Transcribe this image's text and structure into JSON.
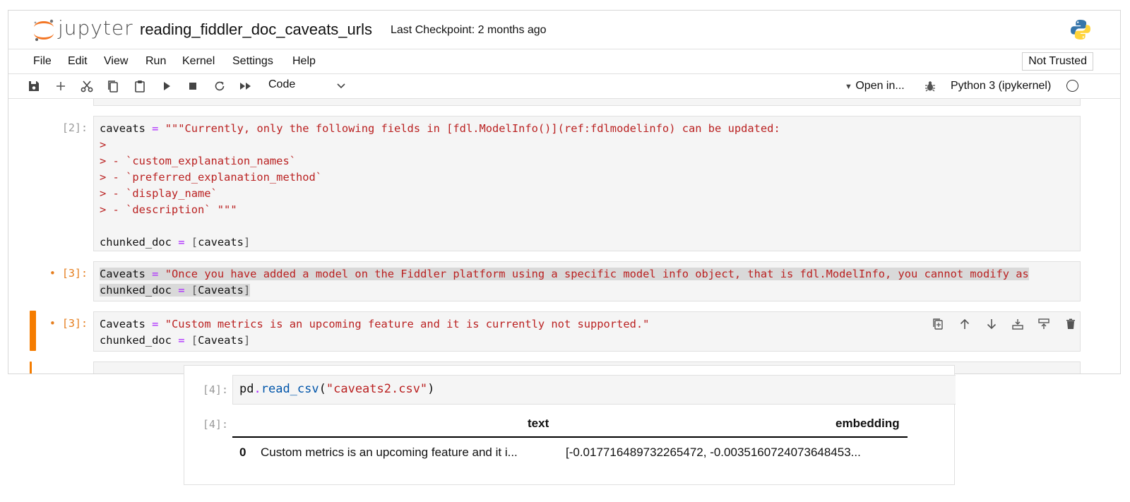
{
  "header": {
    "logo_text": "jupyter",
    "notebook_title": "reading_fiddler_doc_caveats_urls",
    "checkpoint": "Last Checkpoint: 2 months ago"
  },
  "menu": {
    "items": [
      "File",
      "Edit",
      "View",
      "Run",
      "Kernel",
      "Settings",
      "Help"
    ],
    "trust_badge": "Not Trusted"
  },
  "toolbar": {
    "icons": [
      "save-icon",
      "add-icon",
      "cut-icon",
      "copy-icon",
      "paste-icon",
      "run-icon",
      "stop-icon",
      "restart-icon",
      "fast-forward-icon"
    ],
    "cell_type": "Code",
    "open_in": "Open in...",
    "kernel": "Python 3 (ipykernel)"
  },
  "cells": {
    "c2": {
      "prompt": "[2]:",
      "l1a": "caveats",
      "l1op": "=",
      "l1s": "\"\"\"Currently, only the following fields in [fdl.ModelInfo()](ref:fdlmodelinfo) can be updated:",
      "l2": ">",
      "l3": "> - `custom_explanation_names`",
      "l4": "> - `preferred_explanation_method`",
      "l5": "> - `display_name`",
      "l6": "> - `description` \"\"\"",
      "l8a": "chunked_doc",
      "l8op": "=",
      "l8b": "[",
      "l8c": "caveats",
      "l8d": "]"
    },
    "c3a": {
      "prompt": "• [3]:",
      "l1a": "Caveats",
      "l1op": "=",
      "l1s": "\"Once you have added a model on the Fiddler platform using a specific model info object, that is fdl.ModelInfo, you cannot modify as",
      "l2a": "chunked_doc",
      "l2op": "=",
      "l2b": "[",
      "l2c": "Caveats",
      "l2d": "]"
    },
    "c3b": {
      "prompt": "• [3]:",
      "l1a": "Caveats",
      "l1op": "=",
      "l1s": "\"Custom metrics is an upcoming feature and it is currently not supported.\"",
      "l2a": "chunked_doc",
      "l2op": "=",
      "l2b": "[",
      "l2c": "Caveats",
      "l2d": "]",
      "actions": [
        "duplicate-icon",
        "move-up-icon",
        "move-down-icon",
        "insert-above-icon",
        "insert-below-icon",
        "delete-icon"
      ]
    },
    "c4": {
      "prompt": "[4]:",
      "code_a": "pd",
      "code_b": ".",
      "code_fn": "read_csv",
      "code_c": "(",
      "code_s": "\"caveats2.csv\"",
      "code_d": ")",
      "out_prompt": "[4]:",
      "table": {
        "headers": [
          "",
          "text",
          "embedding"
        ],
        "rows": [
          [
            "0",
            "Custom metrics is an upcoming feature and it i...",
            "[-0.017716489732265472, -0.0035160724073648453..."
          ]
        ]
      }
    }
  }
}
